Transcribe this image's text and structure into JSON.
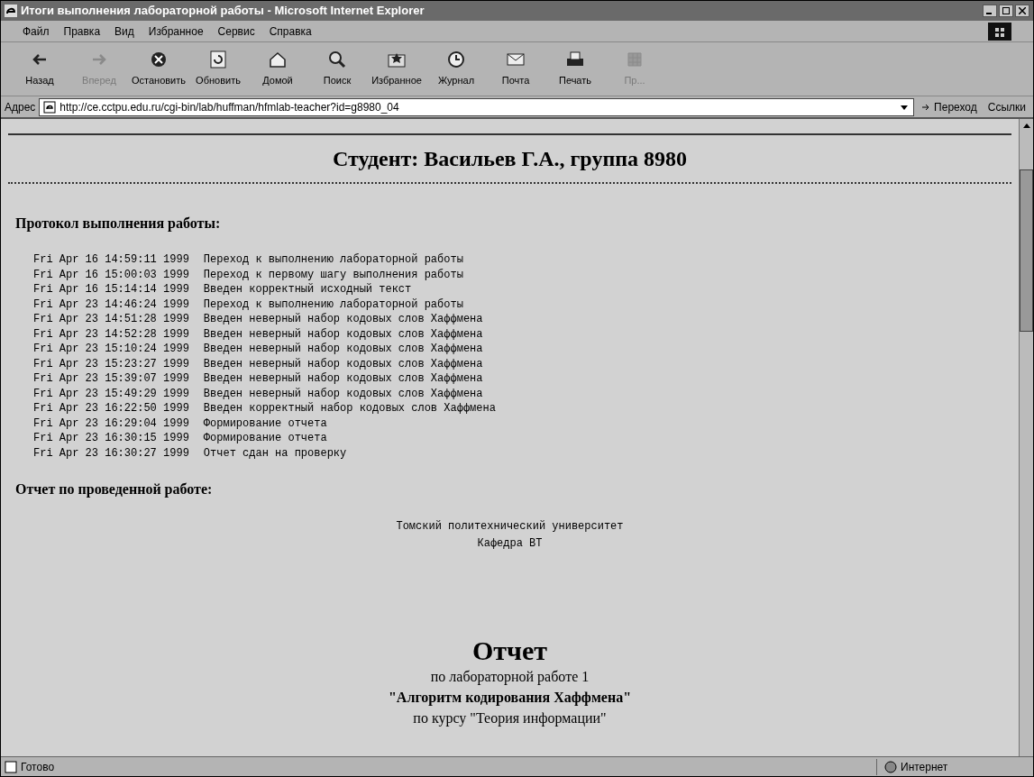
{
  "window": {
    "title": "Итоги выполнения лабораторной работы - Microsoft Internet Explorer"
  },
  "menu": [
    "Файл",
    "Правка",
    "Вид",
    "Избранное",
    "Сервис",
    "Справка"
  ],
  "toolbar": [
    {
      "label": "Назад",
      "kind": "back",
      "disabled": false
    },
    {
      "label": "Вперед",
      "kind": "forward",
      "disabled": true
    },
    {
      "label": "Остановить",
      "kind": "stop",
      "disabled": false
    },
    {
      "label": "Обновить",
      "kind": "refresh",
      "disabled": false
    },
    {
      "label": "Домой",
      "kind": "home",
      "disabled": false
    },
    {
      "label": "Поиск",
      "kind": "search",
      "disabled": false
    },
    {
      "label": "Избранное",
      "kind": "favorites",
      "disabled": false
    },
    {
      "label": "Журнал",
      "kind": "history",
      "disabled": false
    },
    {
      "label": "Почта",
      "kind": "mail",
      "disabled": false
    },
    {
      "label": "Печать",
      "kind": "print",
      "disabled": false
    },
    {
      "label": "Пр...",
      "kind": "edit",
      "disabled": true
    }
  ],
  "address": {
    "label": "Адрес",
    "value": "http://ce.cctpu.edu.ru/cgi-bin/lab/huffman/hfmlab-teacher?id=g8980_04",
    "go": "Переход",
    "links": "Ссылки"
  },
  "page": {
    "heading": "Студент: Васильев Г.А., группа 8980",
    "protocol_title": "Протокол выполнения работы:",
    "log": [
      {
        "time": "Fri Apr 16 14:59:11 1999",
        "event": "Переход к выполнению лабораторной работы"
      },
      {
        "time": "Fri Apr 16 15:00:03 1999",
        "event": "Переход к первому шагу выполнения работы"
      },
      {
        "time": "Fri Apr 16 15:14:14 1999",
        "event": "Введен корректный исходный текст"
      },
      {
        "time": "Fri Apr 23 14:46:24 1999",
        "event": "Переход к выполнению лабораторной работы"
      },
      {
        "time": "Fri Apr 23 14:51:28 1999",
        "event": "Введен неверный набор кодовых слов Хаффмена"
      },
      {
        "time": "Fri Apr 23 14:52:28 1999",
        "event": "Введен неверный набор кодовых слов Хаффмена"
      },
      {
        "time": "Fri Apr 23 15:10:24 1999",
        "event": "Введен неверный набор кодовых слов Хаффмена"
      },
      {
        "time": "Fri Apr 23 15:23:27 1999",
        "event": "Введен неверный набор кодовых слов Хаффмена"
      },
      {
        "time": "Fri Apr 23 15:39:07 1999",
        "event": "Введен неверный набор кодовых слов Хаффмена"
      },
      {
        "time": "Fri Apr 23 15:49:29 1999",
        "event": "Введен неверный набор кодовых слов Хаффмена"
      },
      {
        "time": "Fri Apr 23 16:22:50 1999",
        "event": "Введен корректный набор кодовых слов Хаффмена"
      },
      {
        "time": "Fri Apr 23 16:29:04 1999",
        "event": "Формирование отчета"
      },
      {
        "time": "Fri Apr 23 16:30:15 1999",
        "event": "Формирование отчета"
      },
      {
        "time": "Fri Apr 23 16:30:27 1999",
        "event": "Отчет сдан на проверку"
      }
    ],
    "report_title": "Отчет по проведенной работе:",
    "university": "Томский политехнический университет",
    "department": "Кафедра ВТ",
    "report_heading": "Отчет",
    "report_lines": [
      "по лабораторной работе 1",
      "\"Алгоритм кодирования Хаффмена\"",
      "по курсу \"Теория информации\""
    ]
  },
  "status_bar": {
    "text": "Готово",
    "zone": "Интернет"
  }
}
